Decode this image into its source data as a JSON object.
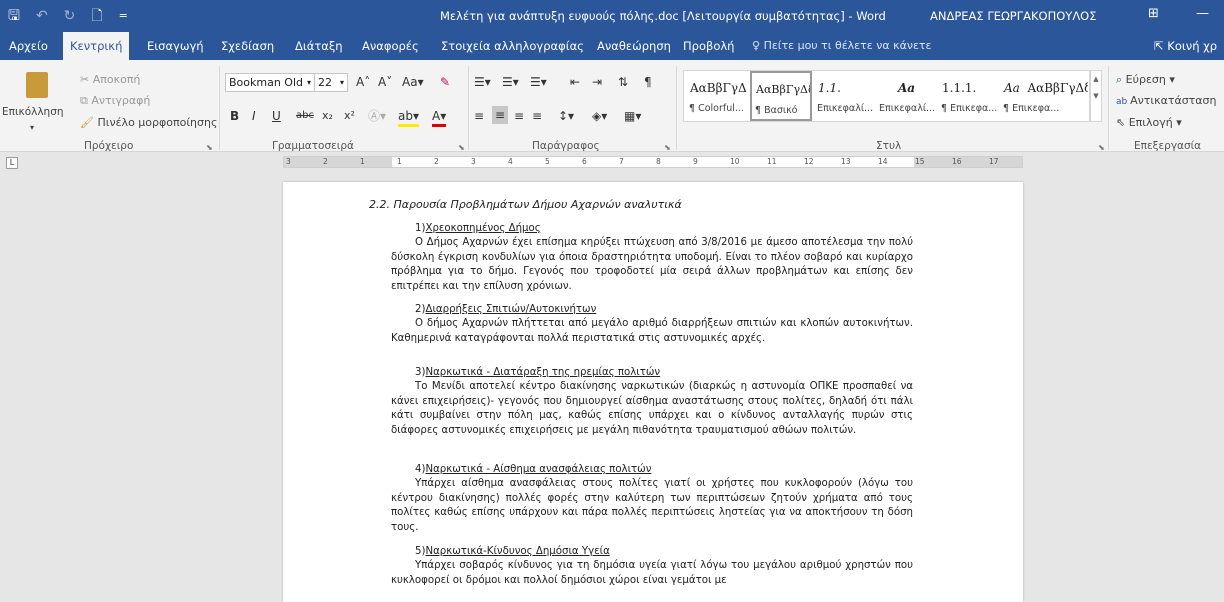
{
  "titlebar": {
    "qat": {
      "save": "🖫",
      "undo": "↶",
      "redo": "↻",
      "preview": "🗋",
      "customize": "="
    },
    "doc_title": "Μελέτη για ανάπτυξη ευφυούς πόλης.doc [Λειτουργία συμβατότητας] - Word",
    "user": "ΑΝΔΡΕΑΣ ΓΕΩΡΓΑΚΟΠΟΥΛΟΣ",
    "ribbon_opts": "⊞",
    "minimize": "—"
  },
  "tabs": [
    {
      "label": "Αρχείο"
    },
    {
      "label": "Κεντρική"
    },
    {
      "label": "Εισαγωγή"
    },
    {
      "label": "Σχεδίαση"
    },
    {
      "label": "Διάταξη"
    },
    {
      "label": "Αναφορές"
    },
    {
      "label": "Στοιχεία αλληλογραφίας"
    },
    {
      "label": "Αναθεώρηση"
    },
    {
      "label": "Προβολή"
    }
  ],
  "tellme": "Πείτε μου τι θέλετε να κάνετε",
  "share": "Κοινή χρ",
  "clipboard": {
    "paste": "Επικόλληση",
    "cut": "Αποκοπή",
    "copy": "Αντιγραφή",
    "format_painter": "Πινέλο μορφοποίησης",
    "group": "Πρόχειρο"
  },
  "font": {
    "name": "Bookman Old",
    "size": "22",
    "group": "Γραμματοσειρά",
    "change_case": "Aa",
    "bold": "B",
    "italic": "I",
    "underline": "U",
    "strike": "abc",
    "sub": "x₂",
    "sup": "x²"
  },
  "paragraph": {
    "group": "Παράγραφος"
  },
  "styles": {
    "group": "Στυλ",
    "items": [
      {
        "preview": "ΑαΒβΓγΔ",
        "name": "¶ Colorful..."
      },
      {
        "preview": "ΑαΒβΓγΔδ",
        "name": "¶ Βασικό"
      },
      {
        "preview": "1.1.",
        "name": "Επικεφαλί..."
      },
      {
        "preview": "Aa",
        "name": "Επικεφαλί..."
      },
      {
        "preview": "1.1.1.",
        "name": "¶ Επικεφα..."
      },
      {
        "preview": "ΑαΒβΓγΔδ",
        "name": "¶ Επικεφα..."
      }
    ],
    "extra_preview": "ΑαΒβΓγΔδ",
    "extra_preview2": "Aa"
  },
  "editing": {
    "group": "Επεξεργασία",
    "find": "Εύρεση",
    "replace": "Αντικατάσταση",
    "select": "Επιλογή"
  },
  "document": {
    "heading": "2.2.   Παρουσία Προβλημάτων Δήμου Αχαρνών αναλυτικά",
    "sections": [
      {
        "num": "1)",
        "title": "Χρεοκοπημένος Δήμος",
        "text": "Ο Δήμος Αχαρνών έχει επίσημα κηρύξει πτώχευση από 3/8/2016 με άμεσο αποτέλεσμα την πολύ δύσκολη έγκριση κονδυλίων για όποια δραστηριότητα υποδομή. Είναι το πλέον σοβαρό και κυρίαρχο πρόβλημα για το δήμο. Γεγονός που τροφοδοτεί μία σειρά άλλων προβλημάτων και επίσης δεν επιτρέπει και την επίλυση χρόνιων."
      },
      {
        "num": "2)",
        "title": "Διαρρήξεις Σπιτιών/Αυτοκινήτων",
        "text": "Ο δήμος Αχαρνών πλήττεται από μεγάλο αριθμό διαρρήξεων σπιτιών και κλοπών αυτοκινήτων. Καθημερινά καταγράφονται πολλά περιστατικά στις αστυνομικές αρχές."
      },
      {
        "num": "3)",
        "title": "Ναρκωτικά - Διατάραξη της ηρεμίας πολιτών",
        "text": "Το Μενίδι αποτελεί κέντρο διακίνησης ναρκωτικών (διαρκώς η αστυνομία ΟΠΚΕ προσπαθεί να κάνει επιχειρήσεις)- γεγονός που δημιουργεί αίσθημα αναστάτωσης στους πολίτες, δηλαδή ότι πάλι κάτι συμβαίνει στην πόλη μας, καθώς επίσης υπάρχει και ο κίνδυνος ανταλλαγής πυρών στις διάφορες αστυνομικές επιχειρήσεις με μεγάλη πιθανότητα τραυματισμού αθώων πολιτών."
      },
      {
        "num": "4)",
        "title": "Ναρκωτικά - Αίσθημα ανασφάλειας πολιτών",
        "text": "Υπάρχει αίσθημα ανασφάλειας στους πολίτες γιατί οι χρήστες που κυκλοφορούν (λόγω του κέντρου διακίνησης) πολλές φορές στην καλύτερη των περιπτώσεων ζητούν χρήματα από τους πολίτες καθώς επίσης υπάρχουν και πάρα πολλές περιπτώσεις ληστείας για να αποκτήσουν τη δόση τους."
      },
      {
        "num": "5)",
        "title": "Ναρκωτικά-Κίνδυνος Δημόσια Υγεία",
        "text": "Υπάρχει σοβαρός κίνδυνος για τη δημόσια υγεία γιατί λόγω του μεγάλου αριθμού χρηστών που κυκλοφορεί οι δρόμοι και πολλοί δημόσιοι χώροι είναι γεμάτοι με"
      }
    ]
  },
  "ruler": {
    "ticks": [
      "3",
      "2",
      "1",
      "1",
      "2",
      "3",
      "4",
      "5",
      "6",
      "7",
      "8",
      "9",
      "10",
      "11",
      "12",
      "13",
      "14",
      "15",
      "16",
      "17"
    ]
  }
}
